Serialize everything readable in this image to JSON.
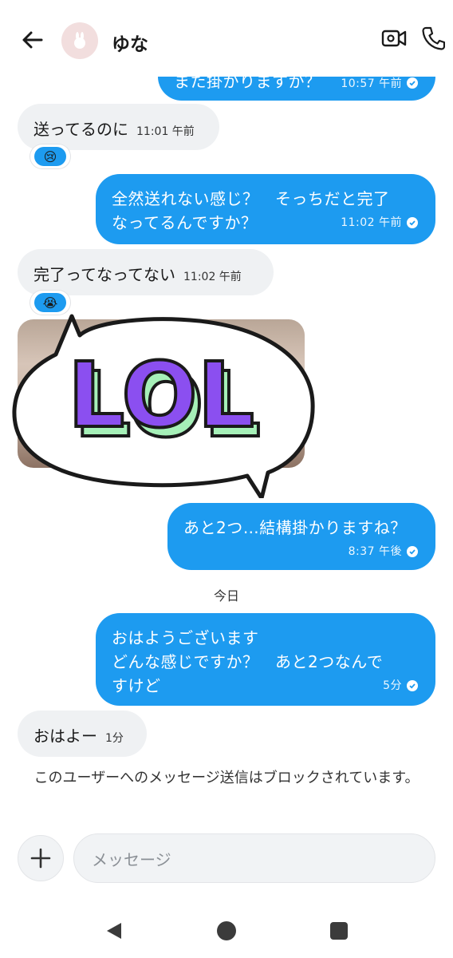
{
  "header": {
    "contact_name": "ゆな",
    "icons": [
      "back-arrow-icon",
      "bunny-avatar-icon",
      "video-call-icon",
      "phone-icon"
    ]
  },
  "messages": {
    "m0": {
      "text": "また掛かりますか？",
      "time": "10:57 午前"
    },
    "m1": {
      "text": "送ってるのに",
      "time": "11:01 午前",
      "reaction": "😢"
    },
    "m2": {
      "line1": "全然送れない感じ？　そっちだと完了",
      "line2": "なってるんですか？",
      "time": "11:02 午前"
    },
    "m3": {
      "text": "完了ってなってない",
      "time": "11:02 午前",
      "reaction": "😭"
    },
    "sticker": {
      "text": "LOL"
    },
    "m4": {
      "text": "あと2つ…結構掛かりますね？",
      "time": "8:37 午後"
    },
    "m5": {
      "line1": "おはようございます",
      "line2": "どんな感じですか？　あと2つなんで",
      "line3": "すけど",
      "time": "5分"
    },
    "m6": {
      "text": "おはよー",
      "time": "1分"
    }
  },
  "divider": {
    "today": "今日"
  },
  "notice": {
    "blocked": "このユーザーへのメッセージ送信はブロックされています。"
  },
  "composer": {
    "placeholder": "メッセージ"
  },
  "colors": {
    "accent": "#1d9bf0",
    "incoming": "#eff1f3",
    "sticker_purple": "#8b4ff0",
    "sticker_green": "#a6f0b8"
  }
}
